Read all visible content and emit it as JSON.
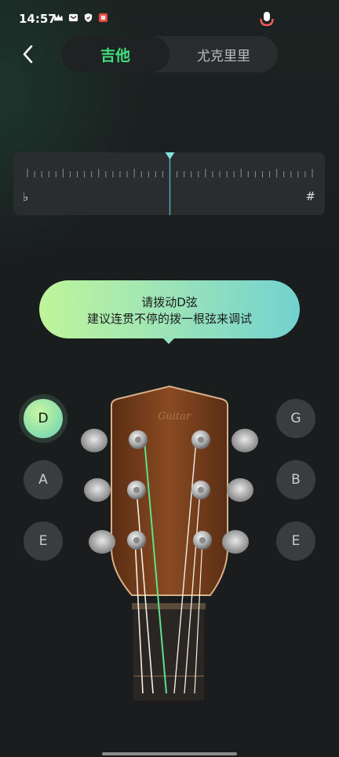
{
  "status_bar": {
    "time": "14:57",
    "icons": [
      "crown-icon",
      "mail-icon",
      "shield-icon",
      "app-badge-icon"
    ],
    "mic_active_color": "#ff5b5b"
  },
  "header": {
    "back_icon": "chevron-left-icon",
    "tabs": [
      {
        "label": "吉他",
        "active": true
      },
      {
        "label": "尤克里里",
        "active": false
      }
    ],
    "accent_color": "#3fe07e"
  },
  "meter": {
    "flat_label": "♭",
    "sharp_label": "#",
    "needle_color": "#7fe3e0",
    "deviation": 0
  },
  "hint": {
    "line1": "请拨动D弦",
    "line2": "建议连贯不停的拨一根弦来调试"
  },
  "strings": {
    "left": [
      {
        "label": "D",
        "active": true
      },
      {
        "label": "A",
        "active": false
      },
      {
        "label": "E",
        "active": false
      }
    ],
    "right": [
      {
        "label": "G",
        "active": false
      },
      {
        "label": "B",
        "active": false
      },
      {
        "label": "E",
        "active": false
      }
    ]
  },
  "headstock": {
    "brand_mark": "Guitar",
    "highlighted_string_color": "#5fe08a"
  }
}
